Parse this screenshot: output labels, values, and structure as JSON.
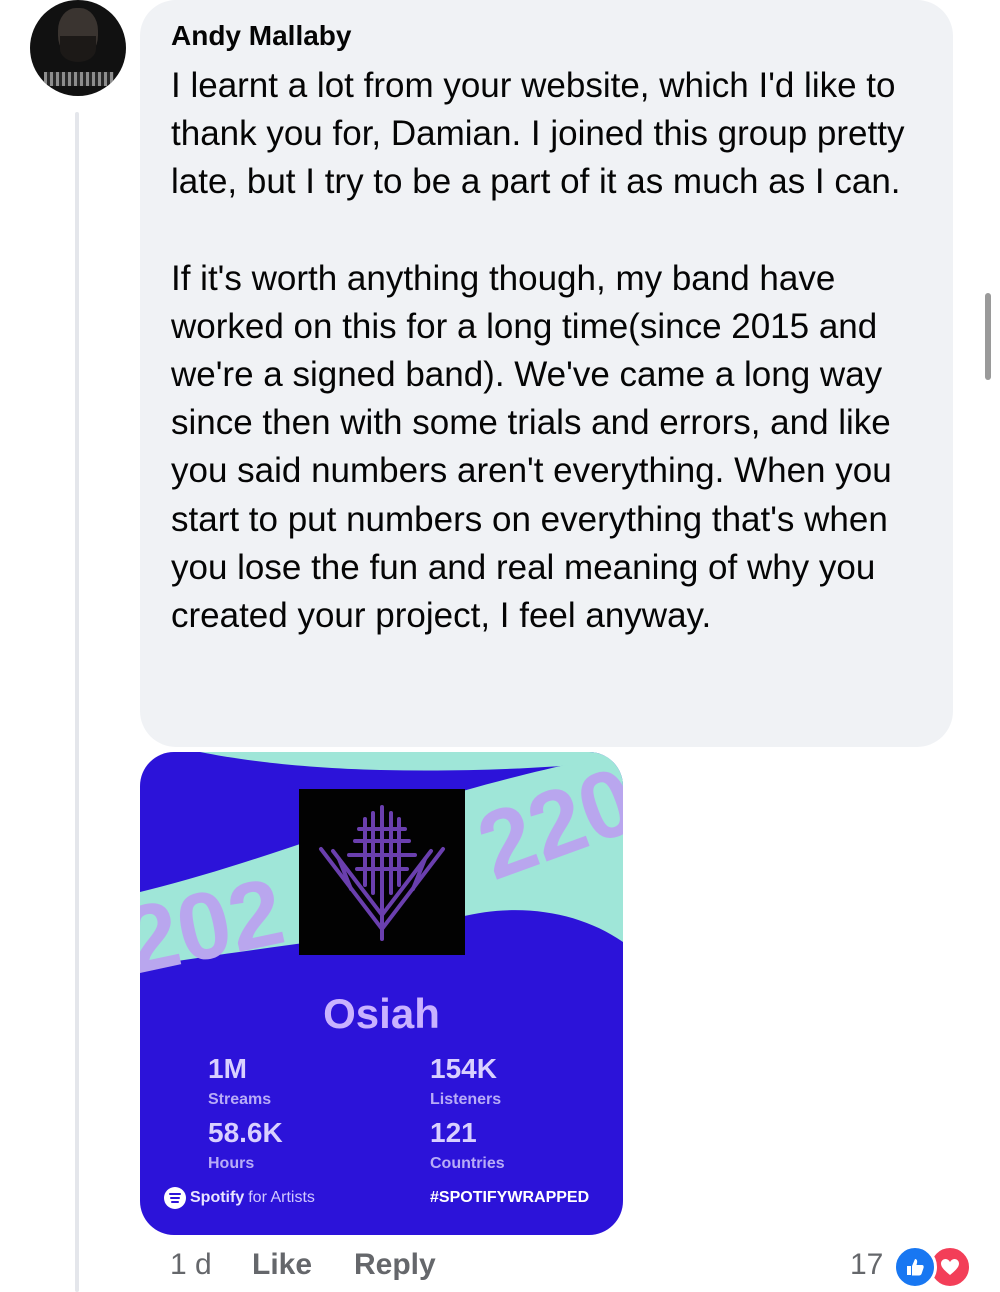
{
  "comment": {
    "author": "Andy Mallaby",
    "paragraphs": [
      "I learnt a lot from your website, which I'd like to thank you for, Damian. I joined this group pretty late, but I try to be a part of it as much as I can.",
      "If it's worth anything though, my band have worked on this for a long time(since 2015 and we're a signed band). We've came a long way since then with some trials and errors, and like you said numbers aren't everything. When you start to put numbers on everything that's when you lose the fun and real meaning of why you created your project, I feel anyway."
    ],
    "timestamp": "1 d",
    "like_label": "Like",
    "reply_label": "Reply",
    "reaction_count": "17",
    "reactions": [
      "like-icon",
      "love-icon"
    ]
  },
  "wrapped_card": {
    "artist": "Osiah",
    "stats": [
      {
        "value": "1M",
        "label": "Streams"
      },
      {
        "value": "154K",
        "label": "Listeners"
      },
      {
        "value": "58.6K",
        "label": "Hours"
      },
      {
        "value": "121",
        "label": "Countries"
      }
    ],
    "brand_name": "Spotify",
    "brand_suffix": "for Artists",
    "hashtag": "#SPOTIFYWRAPPED",
    "colors": {
      "background": "#2c13d9",
      "ribbon": "#9fe6d8",
      "ribbon_text": "#b9a6ee",
      "artist_text": "#c9b2ff"
    }
  }
}
